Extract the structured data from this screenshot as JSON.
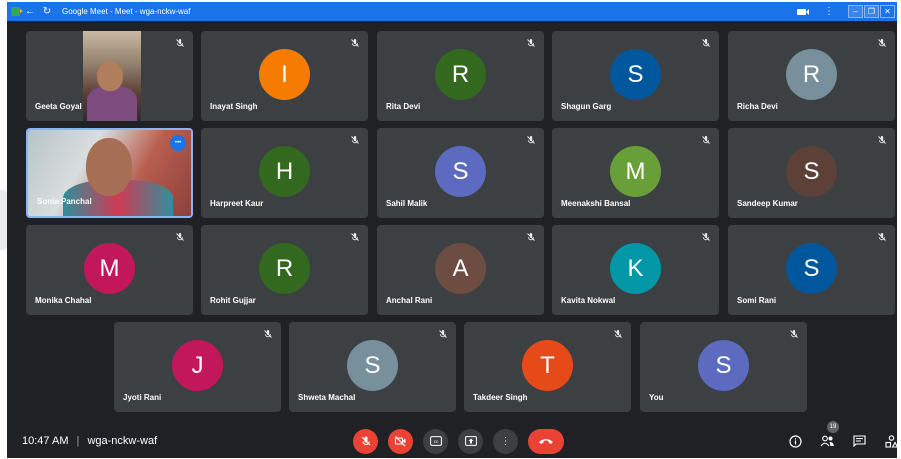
{
  "window": {
    "title": "Google Meet - Meet - wga-nckw-waf"
  },
  "participants": [
    {
      "name": "Geeta Goyal",
      "initial": "",
      "color": "",
      "video": "a",
      "muted": true
    },
    {
      "name": "Inayat Singh",
      "initial": "I",
      "color": "#f57c00",
      "muted": true
    },
    {
      "name": "Rita Devi",
      "initial": "R",
      "color": "#33691e",
      "muted": true
    },
    {
      "name": "Shagun Garg",
      "initial": "S",
      "color": "#01579b",
      "muted": true
    },
    {
      "name": "Richa Devi",
      "initial": "R",
      "color": "#78909c",
      "muted": true
    },
    {
      "name": "Sonia Panchal",
      "initial": "",
      "color": "",
      "video": "b",
      "muted": false,
      "highlighted": true
    },
    {
      "name": "Harpreet Kaur",
      "initial": "H",
      "color": "#33691e",
      "muted": true
    },
    {
      "name": "Sahil Malik",
      "initial": "S",
      "color": "#5c6bc0",
      "muted": true
    },
    {
      "name": "Meenakshi Bansal",
      "initial": "M",
      "color": "#689f38",
      "muted": true
    },
    {
      "name": "Sandeep Kumar",
      "initial": "S",
      "color": "#5d4037",
      "muted": true
    },
    {
      "name": "Monika Chahal",
      "initial": "M",
      "color": "#c2185b",
      "muted": true
    },
    {
      "name": "Rohit Gujjar",
      "initial": "R",
      "color": "#33691e",
      "muted": true
    },
    {
      "name": "Anchal Rani",
      "initial": "A",
      "color": "#6d4c41",
      "muted": true
    },
    {
      "name": "Kavita Nokwal",
      "initial": "K",
      "color": "#0097a7",
      "muted": true
    },
    {
      "name": "Somi Rani",
      "initial": "S",
      "color": "#01579b",
      "muted": true
    },
    {
      "name": "Jyoti Rani",
      "initial": "J",
      "color": "#c2185b",
      "muted": true
    },
    {
      "name": "Shweta Machal",
      "initial": "S",
      "color": "#78909c",
      "muted": true
    },
    {
      "name": "Takdeer Singh",
      "initial": "T",
      "color": "#e64a19",
      "muted": true
    },
    {
      "name": "You",
      "initial": "S",
      "color": "#5c6bc0",
      "muted": true
    }
  ],
  "bottom_bar": {
    "time": "10:47 AM",
    "separator": "|",
    "meeting_code": "wga-nckw-waf",
    "people_count": "19"
  },
  "icons": {
    "mic_off": "mic-off-icon",
    "cam_off": "camera-off-icon",
    "captions": "captions-icon",
    "present": "present-icon",
    "more": "more-vert-icon",
    "end_call": "end-call-icon",
    "info": "info-icon",
    "people": "people-icon",
    "chat": "chat-icon",
    "activities": "activities-icon"
  },
  "colors": {
    "meet_background": "#202124",
    "tile_background": "#3c4043",
    "accent_red": "#ea4335",
    "titlebar_blue": "#1a73e8"
  }
}
